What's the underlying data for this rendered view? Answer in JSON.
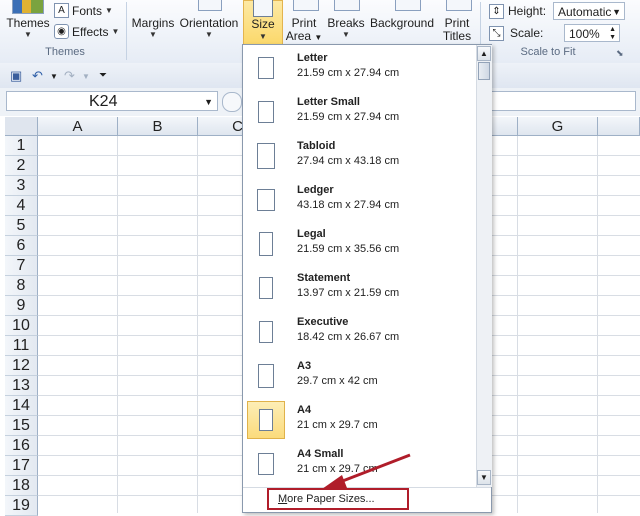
{
  "ribbon": {
    "themes_group": {
      "themes_label": "Themes",
      "fonts_label": "Fonts",
      "effects_label": "Effects",
      "group_label": "Themes"
    },
    "page_setup": {
      "margins_label": "Margins",
      "orientation_label": "Orientation",
      "size_label": "Size",
      "print_area_label_1": "Print",
      "print_area_label_2": "Area",
      "breaks_label": "Breaks",
      "background_label": "Background",
      "print_titles_label_1": "Print",
      "print_titles_label_2": "Titles"
    },
    "scale_to_fit": {
      "height_label": "Height:",
      "height_value": "Automatic",
      "scale_label": "Scale:",
      "scale_value": "100%",
      "group_label": "Scale to Fit"
    }
  },
  "formula_bar": {
    "name_box": "K24"
  },
  "grid": {
    "columns": [
      "A",
      "B",
      "C",
      "G"
    ],
    "rows": [
      "1",
      "2",
      "3",
      "4",
      "5",
      "6",
      "7",
      "8",
      "9",
      "10",
      "11",
      "12",
      "13",
      "14",
      "15",
      "16",
      "17",
      "18",
      "19"
    ]
  },
  "size_menu": {
    "items": [
      {
        "name": "Letter",
        "dims": "21.59 cm x 27.94 cm"
      },
      {
        "name": "Letter Small",
        "dims": "21.59 cm x 27.94 cm"
      },
      {
        "name": "Tabloid",
        "dims": "27.94 cm x 43.18 cm"
      },
      {
        "name": "Ledger",
        "dims": "43.18 cm x 27.94 cm"
      },
      {
        "name": "Legal",
        "dims": "21.59 cm x 35.56 cm"
      },
      {
        "name": "Statement",
        "dims": "13.97 cm x 21.59 cm"
      },
      {
        "name": "Executive",
        "dims": "18.42 cm x 26.67 cm"
      },
      {
        "name": "A3",
        "dims": "29.7 cm x 42 cm"
      },
      {
        "name": "A4",
        "dims": "21 cm x 29.7 cm"
      },
      {
        "name": "A4 Small",
        "dims": "21 cm x 29.7 cm"
      }
    ],
    "selected": "A4",
    "more_label": "More Paper Sizes..."
  },
  "colors": {
    "highlight": "#fbd86a",
    "callout_red": "#b01d2a"
  }
}
